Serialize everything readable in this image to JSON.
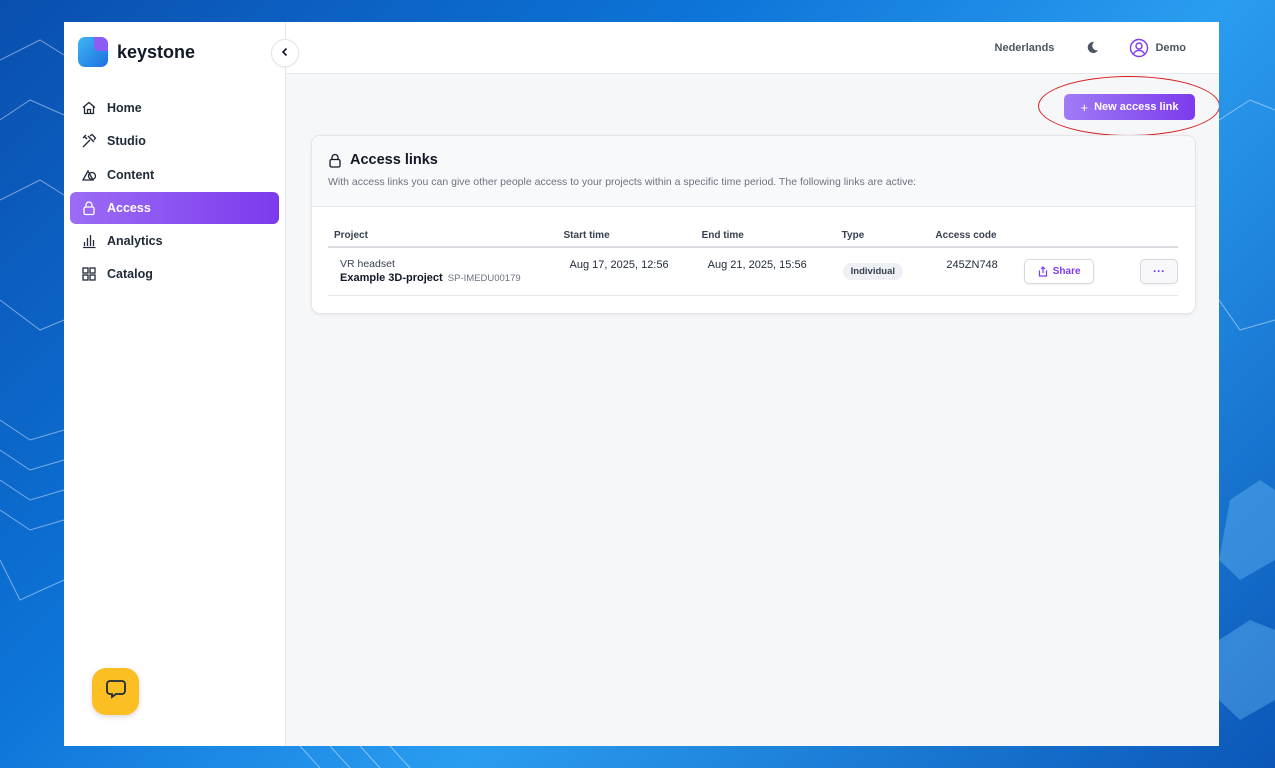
{
  "brand": {
    "name": "keystone"
  },
  "sidebar": {
    "items": [
      {
        "label": "Home",
        "icon": "home-icon"
      },
      {
        "label": "Studio",
        "icon": "tools-icon"
      },
      {
        "label": "Content",
        "icon": "shapes-icon"
      },
      {
        "label": "Access",
        "icon": "lock-icon",
        "active": true
      },
      {
        "label": "Analytics",
        "icon": "bar-chart-icon"
      },
      {
        "label": "Catalog",
        "icon": "grid-icon"
      }
    ]
  },
  "topbar": {
    "language": "Nederlands",
    "user": "Demo"
  },
  "actions": {
    "new_access_link": "New access link"
  },
  "access_links": {
    "title": "Access links",
    "description": "With access links you can give other people access to your projects within a specific time period. The following links are active:",
    "columns": [
      "Project",
      "Start time",
      "End time",
      "Type",
      "Access code"
    ],
    "rows": [
      {
        "project_sub": "VR headset",
        "project_name": "Example 3D-project",
        "project_code": "SP-IMEDU00179",
        "start": "Aug 17, 2025, 12:56",
        "end": "Aug 21, 2025, 15:56",
        "type": "Individual",
        "code": "245ZN748",
        "share": "Share",
        "more": "···"
      }
    ]
  },
  "colors": {
    "accent": "#7c3aed",
    "annotation": "#d61f1f",
    "chat": "#fbbf24"
  }
}
